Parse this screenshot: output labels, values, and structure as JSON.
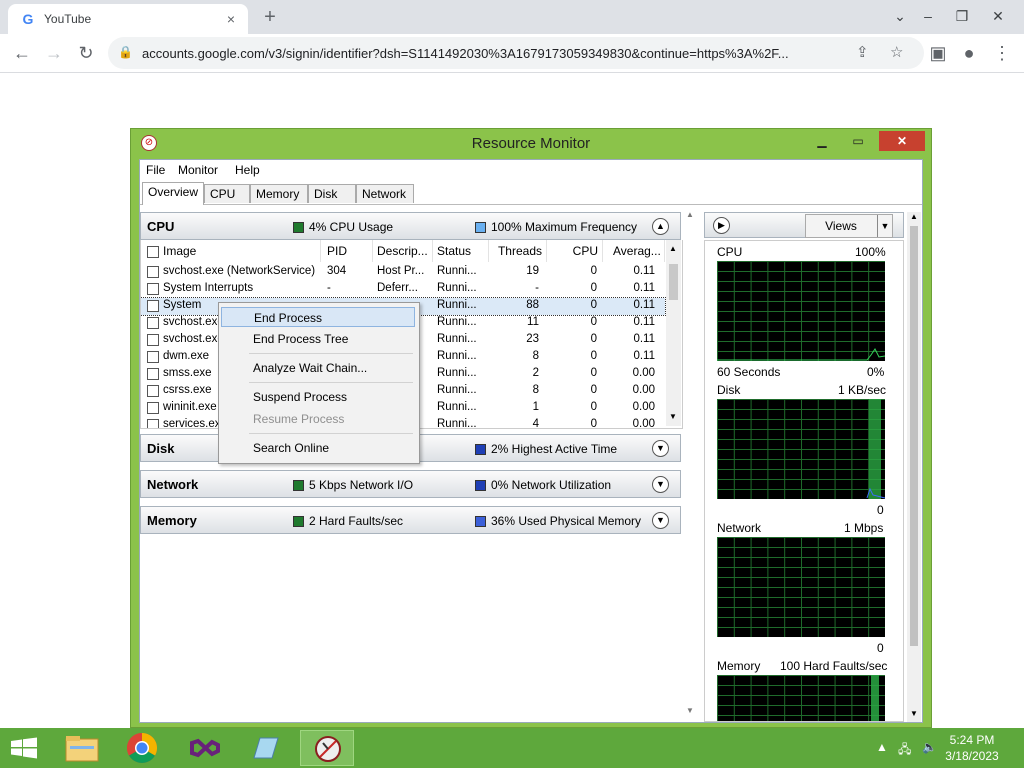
{
  "browser": {
    "tab_title": "YouTube",
    "tab_close": "×",
    "new_tab": "+",
    "url": "accounts.google.com/v3/signin/identifier?dsh=S1141492030%3A1679173059349830&continue=https%3A%2F...",
    "win_minimize": "⌄",
    "win_restore": "–",
    "win_maximize": "❐",
    "win_close": "✕"
  },
  "rm": {
    "title": "Resource Monitor",
    "menu": [
      "File",
      "Monitor",
      "Help"
    ],
    "tabs": [
      "Overview",
      "CPU",
      "Memory",
      "Disk",
      "Network"
    ],
    "cpu": {
      "label": "CPU",
      "usage": "4% CPU Usage",
      "freq": "100% Maximum Frequency",
      "columns": [
        "Image",
        "PID",
        "Descrip...",
        "Status",
        "Threads",
        "CPU",
        "Averag..."
      ],
      "rows": [
        [
          "svchost.exe (NetworkService)",
          "304",
          "Host Pr...",
          "Runni...",
          "19",
          "0",
          "0.11"
        ],
        [
          "System Interrupts",
          "-",
          "Deferr...",
          "Runni...",
          "-",
          "0",
          "0.11"
        ],
        [
          "System",
          "",
          "",
          "Runni...",
          "88",
          "0",
          "0.11"
        ],
        [
          "svchost.exe",
          "",
          "",
          "Runni...",
          "11",
          "0",
          "0.11"
        ],
        [
          "svchost.exe",
          "",
          "",
          "Runni...",
          "23",
          "0",
          "0.11"
        ],
        [
          "dwm.exe",
          "",
          "",
          "Runni...",
          "8",
          "0",
          "0.11"
        ],
        [
          "smss.exe",
          "",
          "",
          "Runni...",
          "2",
          "0",
          "0.00"
        ],
        [
          "csrss.exe",
          "",
          "",
          "Runni...",
          "8",
          "0",
          "0.00"
        ],
        [
          "wininit.exe",
          "",
          "",
          "Runni...",
          "1",
          "0",
          "0.00"
        ],
        [
          "services.exe",
          "",
          "",
          "Runni...",
          "4",
          "0",
          "0.00"
        ]
      ]
    },
    "disk": {
      "label": "Disk",
      "stat2": "2% Highest Active Time"
    },
    "network": {
      "label": "Network",
      "stat1": "5 Kbps Network I/O",
      "stat2": "0% Network Utilization"
    },
    "memory": {
      "label": "Memory",
      "stat1": "2 Hard Faults/sec",
      "stat2": "36% Used Physical Memory"
    },
    "context_menu": [
      "End Process",
      "End Process Tree",
      "Analyze Wait Chain...",
      "Suspend Process",
      "Resume Process",
      "Search Online"
    ],
    "views_label": "Views",
    "graphs": {
      "cpu_label": "CPU",
      "cpu_max": "100%",
      "cpu_time": "60 Seconds",
      "cpu_min": "0%",
      "disk_label": "Disk",
      "disk_max": "1 KB/sec",
      "disk_min": "0",
      "net_label": "Network",
      "net_max": "1 Mbps",
      "net_min": "0",
      "mem_label": "Memory",
      "mem_max": "100 Hard Faults/sec"
    }
  },
  "taskbar": {
    "time": "5:24 PM",
    "date": "3/18/2023"
  }
}
